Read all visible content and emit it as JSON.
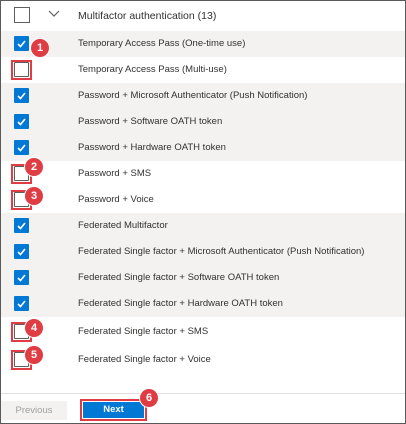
{
  "header": {
    "title": "Multifactor authentication (13)"
  },
  "methods": [
    {
      "label": "Temporary Access Pass (One-time use)",
      "checked": true
    },
    {
      "label": "Temporary Access Pass (Multi-use)",
      "checked": false
    },
    {
      "label": "Password + Microsoft Authenticator (Push Notification)",
      "checked": true
    },
    {
      "label": "Password + Software OATH token",
      "checked": true
    },
    {
      "label": "Password + Hardware OATH token",
      "checked": true
    },
    {
      "label": "Password + SMS",
      "checked": false
    },
    {
      "label": "Password + Voice",
      "checked": false
    },
    {
      "label": "Federated Multifactor",
      "checked": true
    },
    {
      "label": "Federated Single factor + Microsoft Authenticator (Push Notification)",
      "checked": true
    },
    {
      "label": "Federated Single factor + Software OATH token",
      "checked": true
    },
    {
      "label": "Federated Single factor + Hardware OATH token",
      "checked": true
    },
    {
      "label": "Federated Single factor + SMS",
      "checked": false
    },
    {
      "label": "Federated Single factor + Voice",
      "checked": false
    }
  ],
  "callouts": [
    "1",
    "2",
    "3",
    "4",
    "5",
    "6"
  ],
  "footer": {
    "previous_label": "Previous",
    "next_label": "Next"
  },
  "colors": {
    "accent": "#0078d4",
    "annotation": "#e03c43",
    "row_shade": "#f3f2f1"
  }
}
